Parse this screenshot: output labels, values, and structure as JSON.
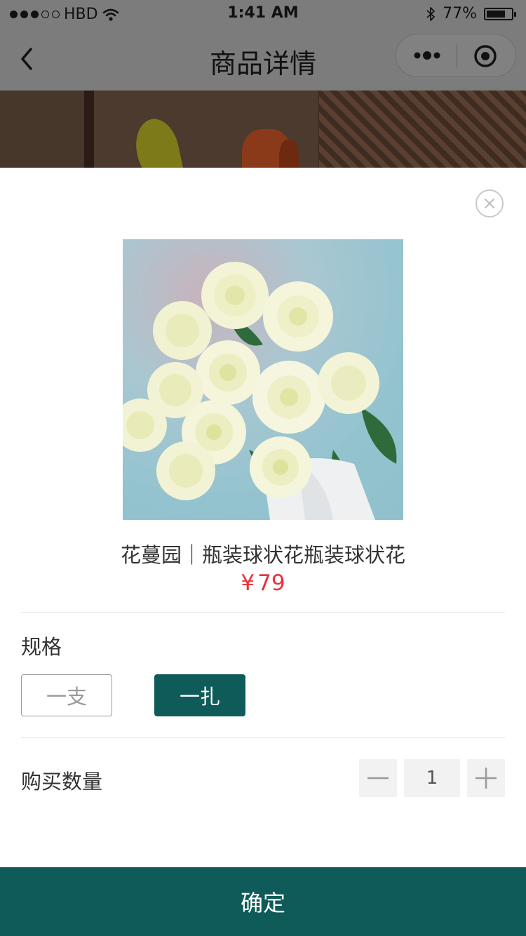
{
  "status_bar": {
    "carrier": "HBD",
    "time": "1:41 AM",
    "battery_percent": "77%",
    "battery_level": 0.77,
    "signal_bars_filled": 3,
    "signal_bars_total": 5
  },
  "nav": {
    "title": "商品详情",
    "back_icon": "chevron-left-icon",
    "more_icon": "more-dots-icon",
    "close_icon": "target-circle-icon"
  },
  "product": {
    "name": "花蔓园｜瓶装球状花瓶装球状花",
    "price_symbol": "¥",
    "price": "79",
    "image_alt": "white roses bouquet"
  },
  "spec": {
    "title": "规格",
    "options": [
      {
        "label": "一支",
        "selected": false
      },
      {
        "label": "一扎",
        "selected": true
      }
    ]
  },
  "quantity": {
    "label": "购买数量",
    "value": "1"
  },
  "confirm": {
    "label": "确定"
  },
  "colors": {
    "accent": "#0e5b5a",
    "price": "#e8333a",
    "overlay": "#7c7c7c"
  }
}
